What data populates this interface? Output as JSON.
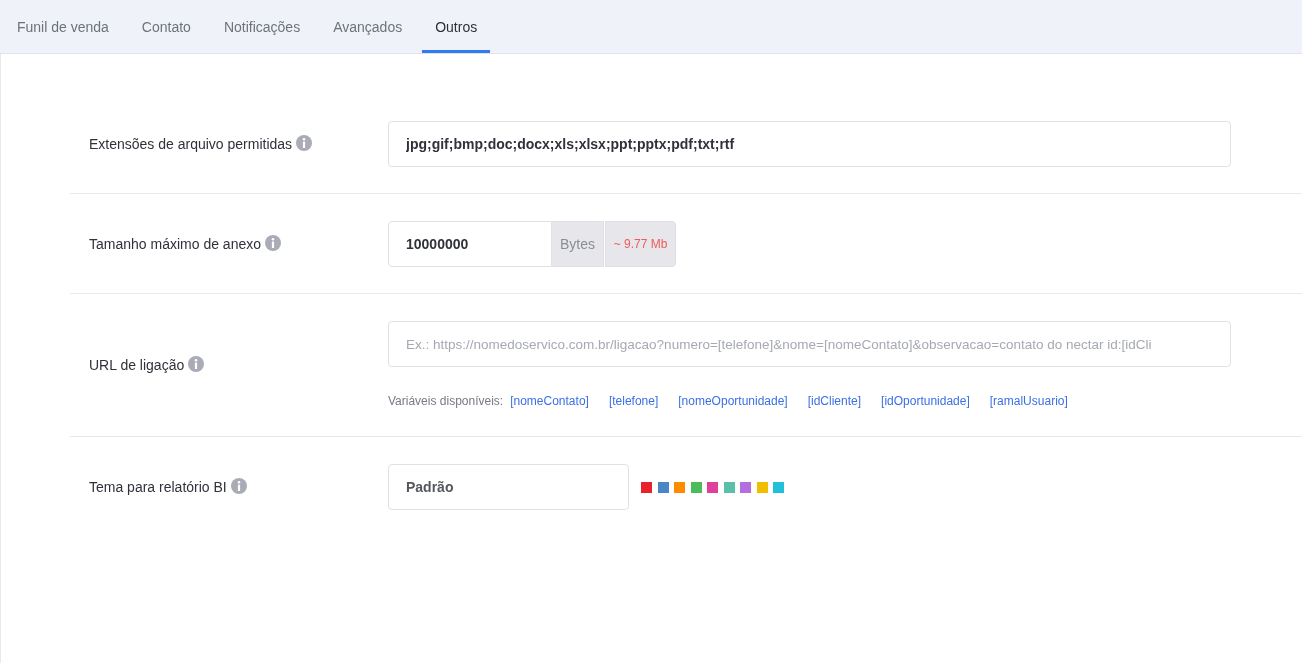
{
  "tabs": [
    {
      "label": "Funil de venda",
      "selected": false
    },
    {
      "label": "Contato",
      "selected": false
    },
    {
      "label": "Notificações",
      "selected": false
    },
    {
      "label": "Avançados",
      "selected": false
    },
    {
      "label": "Outros",
      "selected": true
    }
  ],
  "settings": [
    {
      "kind": "text",
      "label": "Extensões de arquivo permitidas",
      "value": "jpg;gif;bmp;doc;docx;xls;xlsx;ppt;pptx;pdf;txt;rtf"
    },
    {
      "kind": "size",
      "label": "Tamanho máximo de anexo",
      "value": "10000000",
      "unit": "Bytes",
      "conversion": "~ 9.77 Mb"
    },
    {
      "kind": "url",
      "label": "URL de ligação",
      "placeholder": "Ex.: https://nomedoservico.com.br/ligacao?numero=[telefone]&nome=[nomeContato]&observacao=contato do nectar id:[idCli",
      "variables_label": "Variáveis disponíveis:",
      "variables": [
        "[nomeContato]",
        "[telefone]",
        "[nomeOportunidade]",
        "[idCliente]",
        "[idOportunidade]",
        "[ramalUsuario]"
      ]
    },
    {
      "kind": "theme",
      "label": "Tema para relatório BI",
      "value": "Padrão",
      "swatches": [
        {
          "color": "#e8212c"
        },
        {
          "color": "#4a86c5"
        },
        {
          "color": "#ff8c00"
        },
        {
          "color": "#4cbb5a"
        },
        {
          "color": "#e0409a"
        },
        {
          "color": "#5bbfaa"
        },
        {
          "color": "#b56ee0"
        },
        {
          "color": "#f0c000"
        },
        {
          "color": "#22c0d8"
        }
      ]
    }
  ]
}
